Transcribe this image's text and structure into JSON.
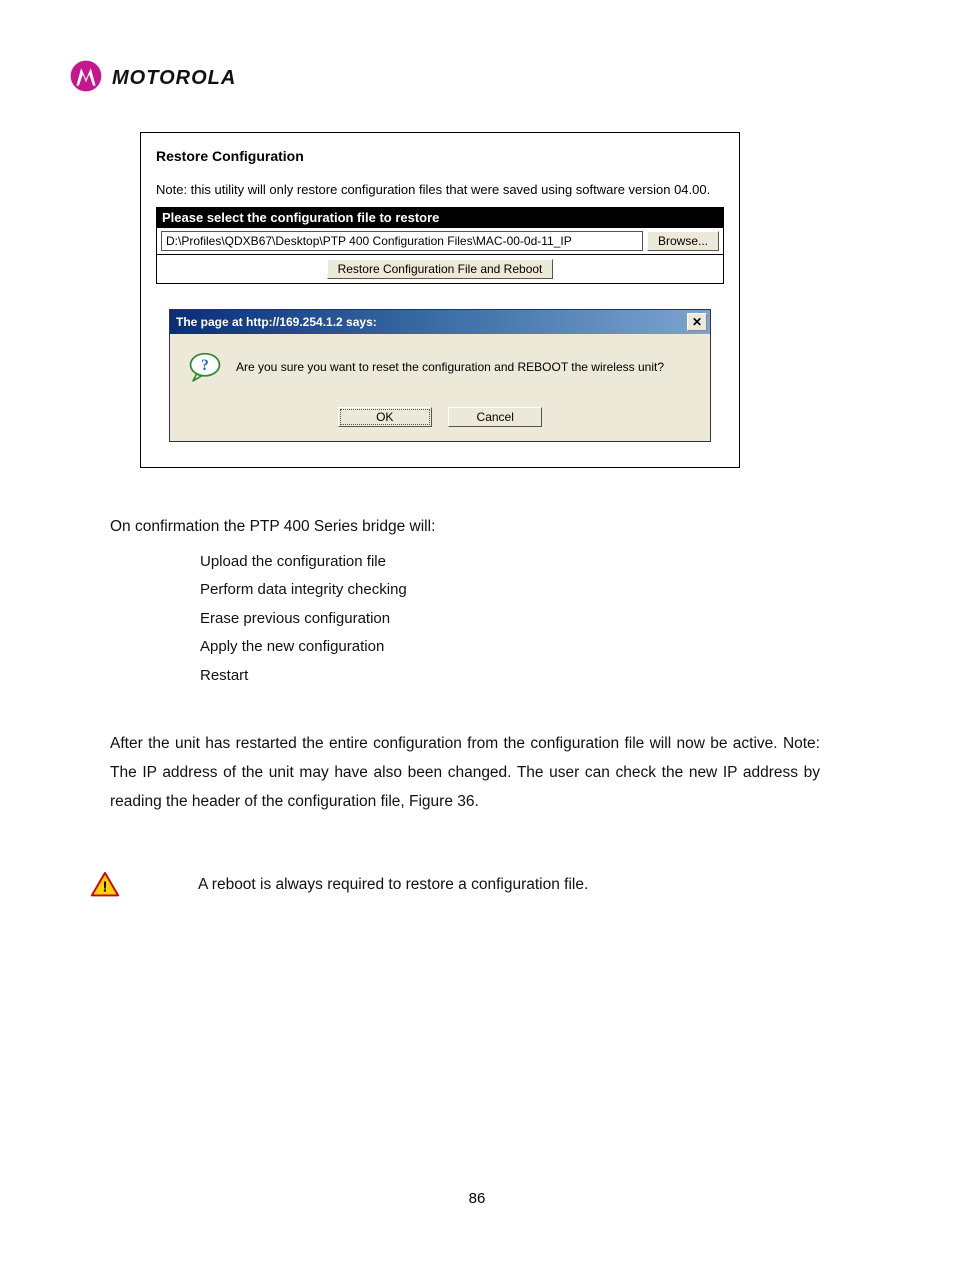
{
  "brand": "MOTOROLA",
  "screenshot": {
    "title": "Restore Configuration",
    "note": "Note: this utility will only restore configuration files that were saved using software version  04.00.",
    "selectHeader": "Please select the configuration file to restore",
    "filePath": "D:\\Profiles\\QDXB67\\Desktop\\PTP 400 Configuration Files\\MAC-00-0d-11_IP",
    "browseLabel": "Browse...",
    "restoreLabel": "Restore Configuration File and Reboot"
  },
  "dialog": {
    "title": "The page at http://169.254.1.2 says:",
    "message": "Are you sure you want to reset the configuration and REBOOT the wireless unit?",
    "okLabel": "OK",
    "cancelLabel": "Cancel"
  },
  "body": {
    "intro": "On confirmation the PTP 400 Series bridge will:",
    "steps": [
      "Upload the configuration file",
      "Perform data integrity checking",
      "Erase previous configuration",
      "Apply the new configuration",
      "Restart"
    ],
    "after": "After the unit has restarted the entire configuration from the configuration file will now be active. Note: The IP address of the unit may have also been changed. The user can check the new IP address by reading the header of the configuration file, Figure 36.",
    "warning": "A reboot is always required to restore a configuration file."
  },
  "pageNumber": "86"
}
